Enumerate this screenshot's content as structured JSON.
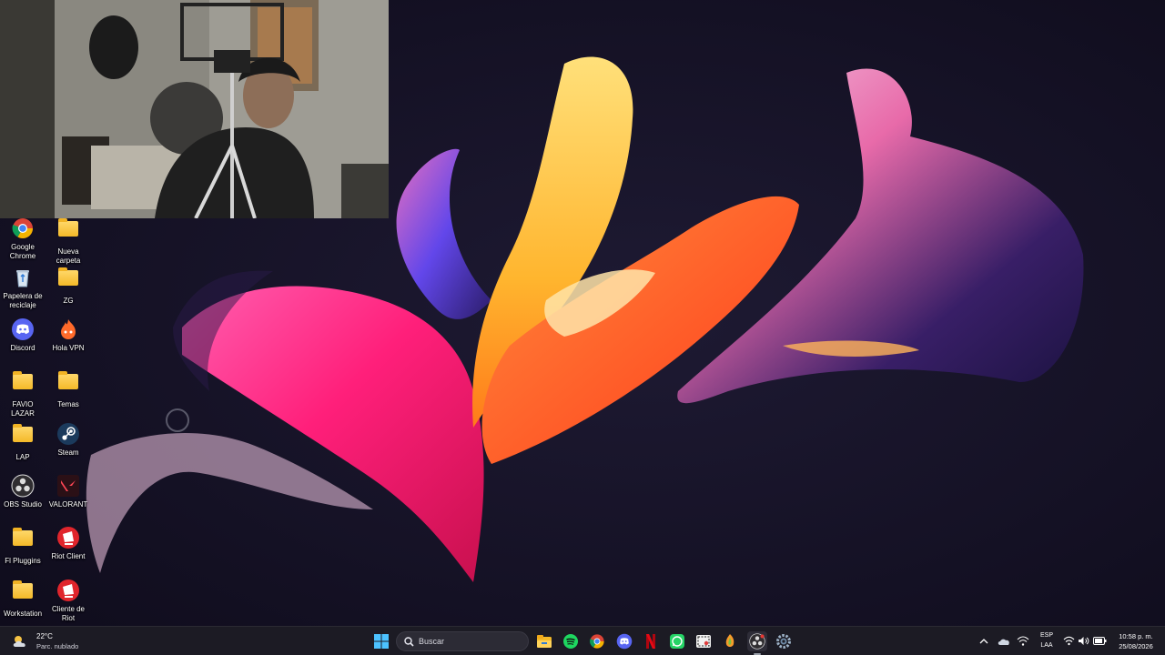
{
  "desktop": {
    "icons": [
      {
        "label": "Google Chrome",
        "icon": "chrome-icon"
      },
      {
        "label": "Nueva carpeta",
        "icon": "folder-icon"
      },
      {
        "label": "Papelera de reciclaje",
        "icon": "recycle-bin-icon"
      },
      {
        "label": "ZG",
        "icon": "folder-icon"
      },
      {
        "label": "Discord",
        "icon": "discord-icon"
      },
      {
        "label": "Hola VPN",
        "icon": "hola-vpn-icon"
      },
      {
        "label": "FAVIO LAZAR",
        "icon": "folder-icon"
      },
      {
        "label": "Temas",
        "icon": "folder-icon"
      },
      {
        "label": "LAP",
        "icon": "folder-icon"
      },
      {
        "label": "Steam",
        "icon": "steam-icon"
      },
      {
        "label": "OBS Studio",
        "icon": "obs-icon"
      },
      {
        "label": "VALORANT",
        "icon": "valorant-icon"
      },
      {
        "label": "Fl Pluggins",
        "icon": "folder-icon"
      },
      {
        "label": "Riot Client",
        "icon": "riot-client-icon"
      },
      {
        "label": "Workstation",
        "icon": "folder-icon"
      },
      {
        "label": "Cliente de Riot",
        "icon": "riot-client-icon"
      }
    ]
  },
  "taskbar": {
    "weather": {
      "temp": "22°C",
      "condition": "Parc. nublado",
      "icon": "partly-cloudy-icon"
    },
    "search": {
      "placeholder": "Buscar"
    },
    "apps": [
      {
        "name": "start",
        "icon": "windows-start-icon"
      },
      {
        "name": "file-explorer",
        "icon": "file-explorer-icon"
      },
      {
        "name": "spotify",
        "icon": "spotify-icon"
      },
      {
        "name": "chrome",
        "icon": "chrome-icon"
      },
      {
        "name": "discord",
        "icon": "discord-icon"
      },
      {
        "name": "netflix",
        "icon": "netflix-icon"
      },
      {
        "name": "whatsapp",
        "icon": "whatsapp-icon"
      },
      {
        "name": "snipping-tool",
        "icon": "snipping-tool-icon"
      },
      {
        "name": "fl-studio",
        "icon": "fl-studio-icon"
      },
      {
        "name": "obs",
        "icon": "obs-icon"
      },
      {
        "name": "settings",
        "icon": "gear-icon"
      }
    ],
    "tray": {
      "language_top": "ESP",
      "language_bottom": "LAA",
      "time": "10:58 p. m.",
      "date": "25/08/2026"
    }
  },
  "colors": {
    "taskbar_bg": "#1c1b24",
    "desktop_bg": "#141122",
    "accent": "#4cc2ff"
  }
}
